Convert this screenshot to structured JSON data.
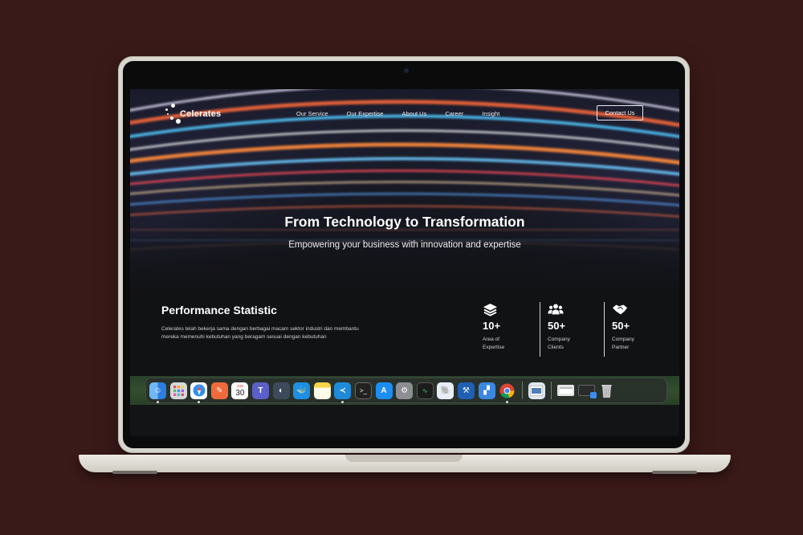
{
  "site": {
    "logo_text": "Celerates",
    "nav": [
      "Our Service",
      "Our Expertise",
      "About Us",
      "Career",
      "Insight"
    ],
    "contact_label": "Contact Us"
  },
  "hero": {
    "title": "From Technology to Transformation",
    "subtitle": "Empowering your business with innovation and expertise"
  },
  "performance": {
    "title": "Performance Statistic",
    "description": "Celerates telah bekerja sama dengan berbagai macam sektor industri dan membantu mereka memenuhi kebutuhan yang beragam sesuai dengan kebutuhan",
    "stats": [
      {
        "icon": "layers-icon",
        "value": "10+",
        "label": "Area of Expertise"
      },
      {
        "icon": "users-icon",
        "value": "50+",
        "label": "Company Clients"
      },
      {
        "icon": "handshake-icon",
        "value": "50+",
        "label": "Company Partner"
      }
    ]
  },
  "dock": {
    "calendar_month": "JUN",
    "calendar_day": "30",
    "apps": [
      "finder-icon",
      "launchpad-icon",
      "safari-icon",
      "pencil-app-icon",
      "calendar-icon",
      "teams-icon",
      "cursor-app-icon",
      "docker-icon",
      "notes-icon",
      "vscode-icon",
      "terminal-icon",
      "app-store-icon",
      "system-settings-icon",
      "activity-monitor-icon",
      "postgres-icon",
      "xcode-icon",
      "app-icon",
      "chrome-icon",
      "preview-icon",
      "window-thumbnail-icon",
      "window-thumbnail-icon",
      "trash-icon"
    ]
  },
  "colors": {
    "background": "#3a1a18",
    "laptop_body": "#d9d6cf",
    "screen_bg": "#111214"
  }
}
